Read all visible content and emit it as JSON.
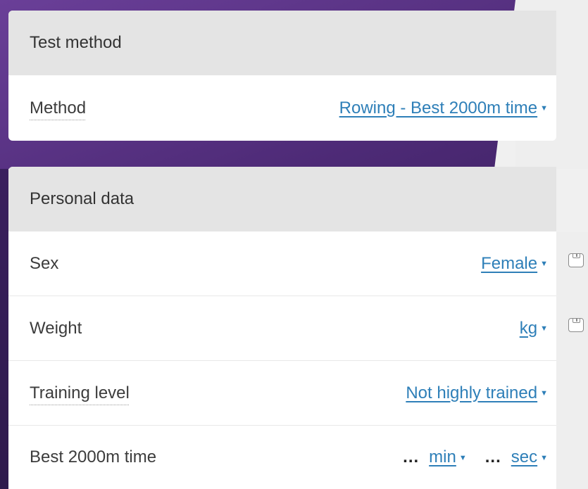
{
  "test_method": {
    "header": "Test method",
    "method_label": "Method",
    "method_value": "Rowing - Best 2000m time"
  },
  "personal_data": {
    "header": "Personal data",
    "sex_label": "Sex",
    "sex_value": "Female",
    "weight_label": "Weight",
    "weight_unit": "kg",
    "training_label": "Training level",
    "training_value": "Not highly trained",
    "time_label": "Best 2000m time",
    "time_min_value": "...",
    "time_min_unit": "min",
    "time_sec_value": "...",
    "time_sec_unit": "sec"
  },
  "icons": {
    "dropdown": "caret-down-icon",
    "save": "save-icon"
  },
  "colors": {
    "link": "#2e7fb8",
    "header_bg": "#e4e4e4",
    "purple_bg": "#4d2a76"
  }
}
